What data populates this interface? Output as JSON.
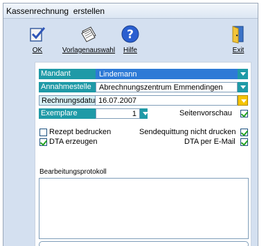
{
  "window": {
    "title": "Kassenrechnung  erstellen"
  },
  "toolbar": {
    "ok": {
      "label": "OK",
      "icon": "checkmark-document-icon"
    },
    "vorlagenauswahl": {
      "label": "Vorlagenauswahl",
      "icon": "templates-icon"
    },
    "hilfe": {
      "label": "Hilfe",
      "icon": "help-icon"
    },
    "exit": {
      "label": "Exit",
      "icon": "exit-door-icon"
    }
  },
  "form": {
    "mandant": {
      "label": "Mandant",
      "value": "Lindemann"
    },
    "annahmestelle": {
      "label": "Annahmestelle",
      "value": "Abrechnungszentrum Emmendingen"
    },
    "rechnungsdatum": {
      "label": "Rechnungsdatum",
      "value": "16.07.2007"
    },
    "exemplare": {
      "label": "Exemplare",
      "value": "1"
    },
    "seitenvorschau": {
      "label": "Seitenvorschau",
      "checked": true
    },
    "rezept_bedrucken": {
      "label": "Rezept bedrucken",
      "checked": false
    },
    "sendequittung": {
      "label": "Sendequittung nicht drucken",
      "checked": true
    },
    "dta_erzeugen": {
      "label": "DTA erzeugen",
      "checked": true
    },
    "dta_email": {
      "label": "DTA per E-Mail",
      "checked": true
    }
  },
  "protocol": {
    "label": "Bearbeitungsprotokoll",
    "text": ""
  },
  "progress": {
    "fraction": 0
  },
  "colors": {
    "label_bg": "#1f9aa7",
    "selected": "#2e7ad6",
    "window_bg": "#d4e0f0"
  }
}
